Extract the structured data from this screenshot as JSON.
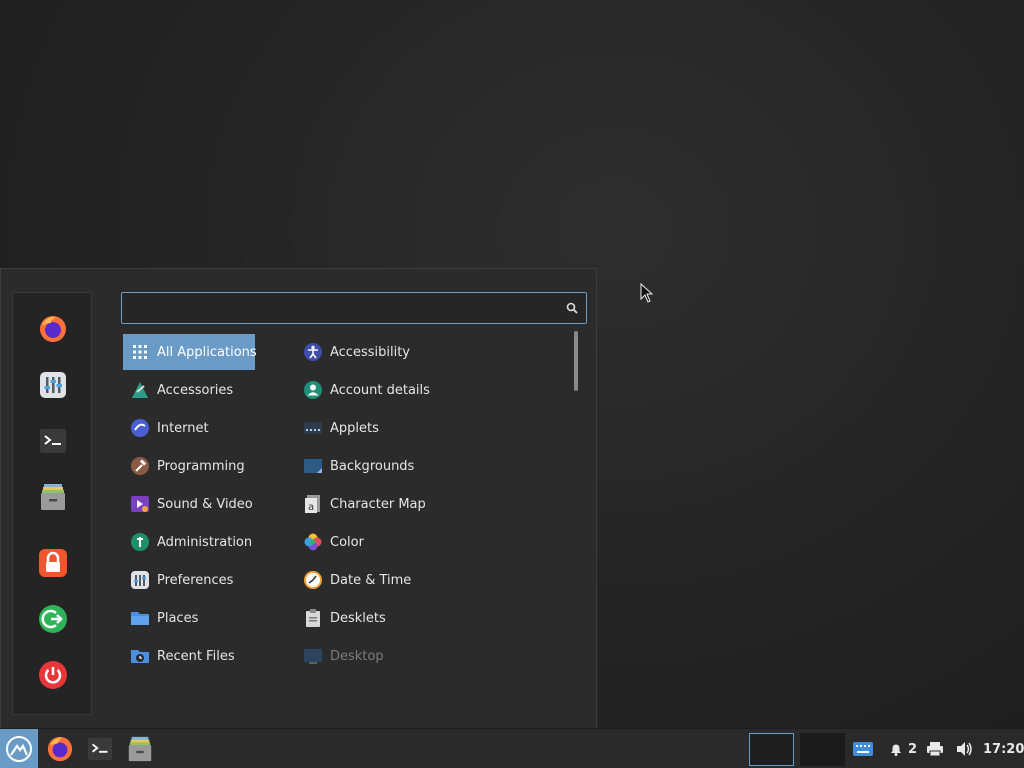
{
  "menu": {
    "search": {
      "placeholder": "",
      "value": ""
    },
    "favorites": [
      {
        "name": "firefox-icon"
      },
      {
        "name": "settings-icon"
      },
      {
        "name": "terminal-icon"
      },
      {
        "name": "files-icon"
      },
      {
        "name": "lock-screen-icon"
      },
      {
        "name": "logout-icon"
      },
      {
        "name": "power-icon"
      }
    ],
    "categories": [
      {
        "label": "All Applications"
      },
      {
        "label": "Accessories"
      },
      {
        "label": "Internet"
      },
      {
        "label": "Programming"
      },
      {
        "label": "Sound & Video"
      },
      {
        "label": "Administration"
      },
      {
        "label": "Preferences"
      },
      {
        "label": "Places"
      },
      {
        "label": "Recent Files"
      }
    ],
    "apps": [
      {
        "label": "Accessibility"
      },
      {
        "label": "Account details"
      },
      {
        "label": "Applets"
      },
      {
        "label": "Backgrounds"
      },
      {
        "label": "Character Map"
      },
      {
        "label": "Color"
      },
      {
        "label": "Date & Time"
      },
      {
        "label": "Desklets"
      },
      {
        "label": "Desktop"
      }
    ]
  },
  "taskbar": {
    "notification_count": "2",
    "clock": "17:20"
  },
  "colors": {
    "accent": "#6a9bc6",
    "panel": "#2b2b2b",
    "taskbar": "#2a2a2a"
  }
}
